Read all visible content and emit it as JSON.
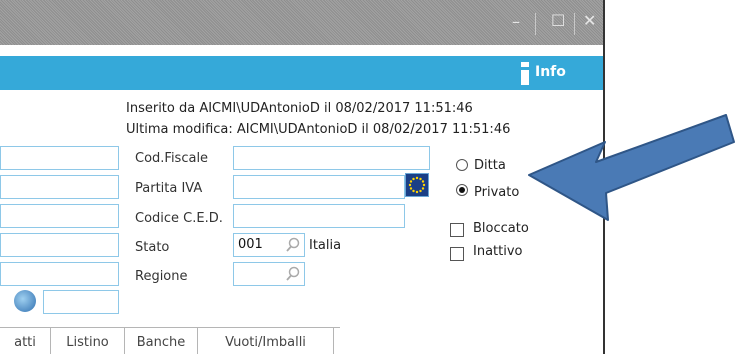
{
  "window": {
    "minimize_glyph": "–",
    "maximize_glyph": "☐",
    "close_glyph": "✕"
  },
  "ribbon": {
    "info_label": "Info",
    "info_icon": "info-icon",
    "color": "#35a9d9"
  },
  "meta": {
    "inserted": "Inserito da AICMI\\UDAntonioD il 08/02/2017 11:51:46",
    "modified": "Ultima modifica: AICMI\\UDAntonioD il 08/02/2017 11:51:46"
  },
  "form": {
    "cod_fiscale": {
      "label": "Cod.Fiscale",
      "value": ""
    },
    "partita_iva": {
      "label": "Partita IVA",
      "value": ""
    },
    "codice_ced": {
      "label": "Codice C.E.D.",
      "value": ""
    },
    "stato": {
      "label": "Stato",
      "code": "001",
      "name": "Italia"
    },
    "regione": {
      "label": "Regione",
      "value": ""
    }
  },
  "type": {
    "ditta": {
      "label": "Ditta",
      "selected": false
    },
    "privato": {
      "label": "Privato",
      "selected": true
    }
  },
  "flags": {
    "bloccato": {
      "label": "Bloccato",
      "checked": false
    },
    "inattivo": {
      "label": "Inattivo",
      "checked": false
    }
  },
  "tabs": [
    "atti",
    "Listino",
    "Banche",
    "Vuoti/Imballi"
  ],
  "annotation": {
    "arrow_color": "#4a7ab5"
  }
}
